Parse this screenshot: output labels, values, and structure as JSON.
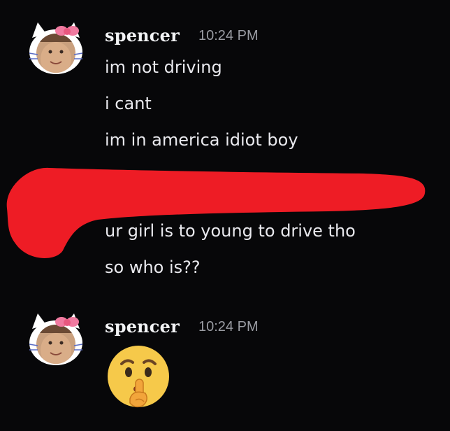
{
  "messages": [
    {
      "author": "spencer",
      "timestamp": "10:24 PM",
      "lines": [
        "im not driving",
        "i cant",
        "im in america idiot boy"
      ]
    },
    {
      "author": "",
      "timestamp": "",
      "lines": [
        "ur girl is to young to drive tho",
        "so who is??"
      ]
    },
    {
      "author": "spencer",
      "timestamp": "10:24 PM",
      "emoji": "shushing-face"
    }
  ],
  "colors": {
    "background": "#070709",
    "text": "#e9e9ee",
    "muted": "#9a9ca3",
    "redaction": "#ee1c25"
  }
}
